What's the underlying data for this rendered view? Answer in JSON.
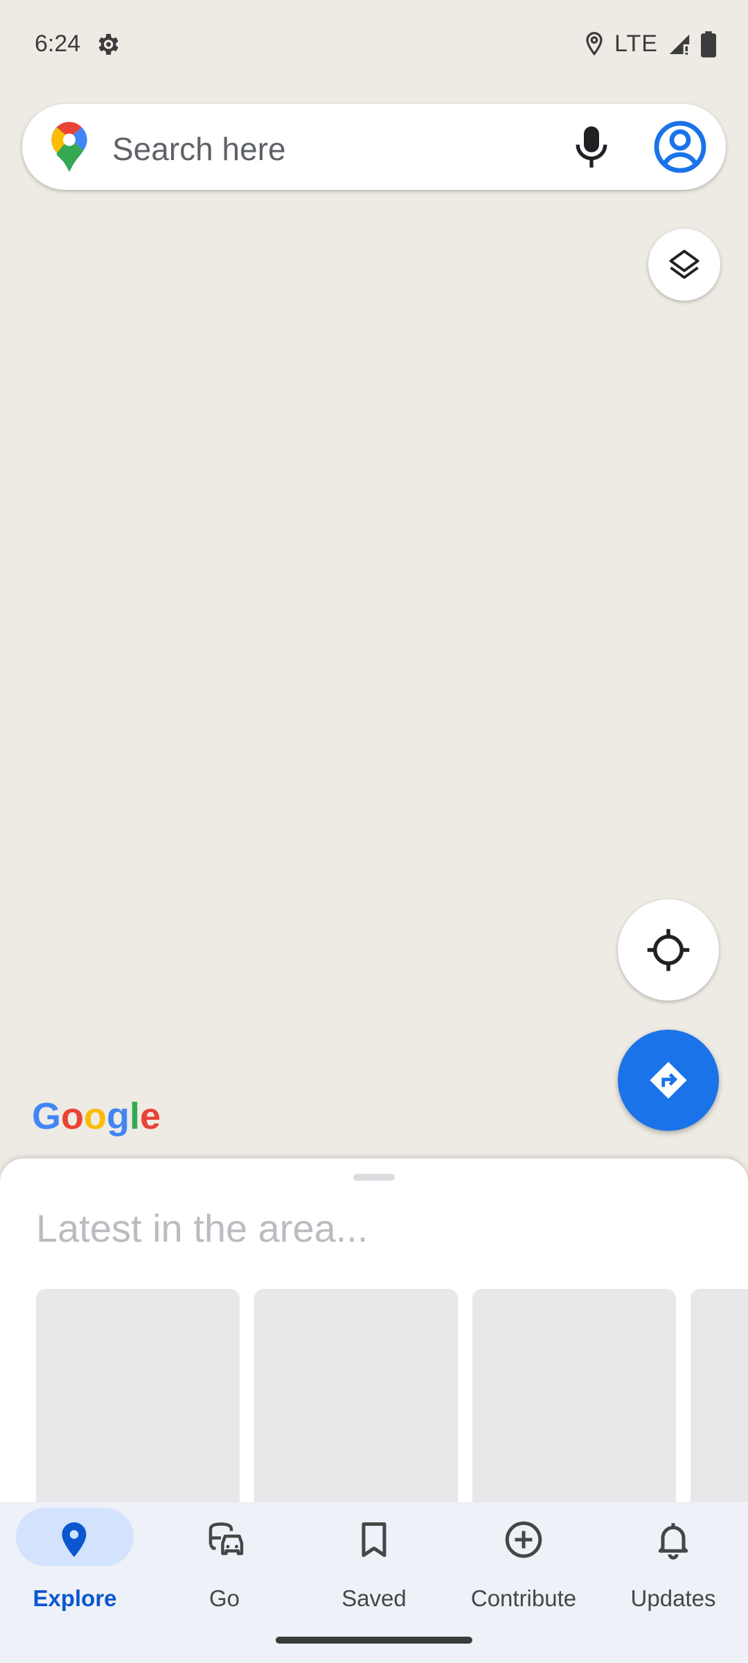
{
  "status_bar": {
    "time": "6:24",
    "network": "LTE"
  },
  "search": {
    "placeholder": "Search here"
  },
  "map": {
    "watermark": "Google",
    "background_color": "#eeebe4"
  },
  "colors": {
    "accent": "#1a73e8",
    "nav_active": "#0b57d0",
    "nav_pill": "#d3e3fd"
  },
  "sheet": {
    "title": "Latest in the area..."
  },
  "bottom_nav": {
    "items": [
      {
        "label": "Explore",
        "icon": "pin-icon",
        "active": true
      },
      {
        "label": "Go",
        "icon": "commute-icon",
        "active": false
      },
      {
        "label": "Saved",
        "icon": "bookmark-icon",
        "active": false
      },
      {
        "label": "Contribute",
        "icon": "add-circle-icon",
        "active": false
      },
      {
        "label": "Updates",
        "icon": "bell-icon",
        "active": false
      }
    ]
  }
}
